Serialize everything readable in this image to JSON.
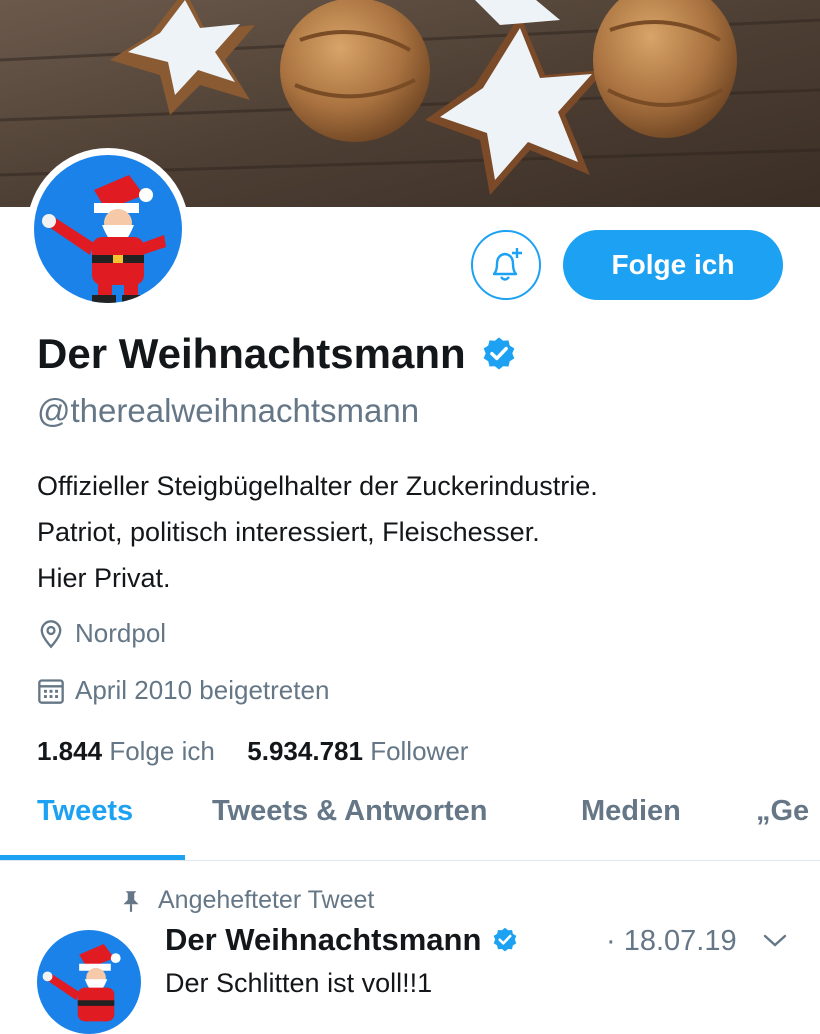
{
  "profile": {
    "name": "Der Weihnachtsmann",
    "handle": "@therealweihnachtsmann",
    "bio": [
      "Offizieller Steigbügelhalter der Zuckerindustrie.",
      "Patriot, politisch interessiert, Fleischesser.",
      "Hier Privat."
    ],
    "location": "Nordpol",
    "joined": "April 2010 beigetreten",
    "following_count": "1.844",
    "following_label": "Folge ich",
    "followers_count": "5.934.781",
    "followers_label": "Follower"
  },
  "actions": {
    "follow_label": "Folge ich",
    "notification_icon": "bell-plus-icon"
  },
  "tabs": [
    {
      "label": "Tweets",
      "active": true
    },
    {
      "label": "Tweets & Antworten",
      "active": false
    },
    {
      "label": "Medien",
      "active": false
    },
    {
      "label": "„Ge",
      "active": false
    }
  ],
  "pinned_tweet": {
    "pinned_label": "Angehefteter Tweet",
    "author": "Der Weihnachtsmann",
    "date": "· 18.07.19",
    "text": "Der Schlitten ist voll!!1"
  },
  "colors": {
    "accent": "#1da1f2",
    "muted": "#657786",
    "text": "#14171a",
    "verified": "#1da1f2"
  }
}
